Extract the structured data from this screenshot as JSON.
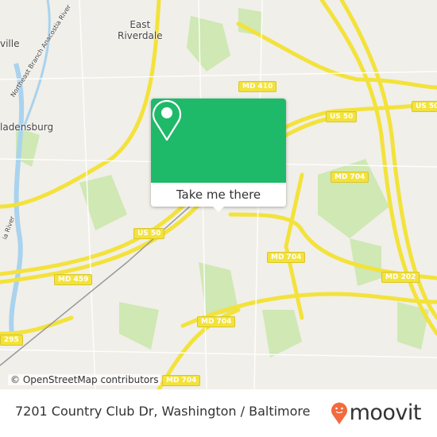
{
  "map": {
    "places": [
      {
        "id": "east-riverdale",
        "label": "East\nRiverdale"
      },
      {
        "id": "bladensburg",
        "label": "ladensburg"
      },
      {
        "id": "hyattsville",
        "label": "ville"
      },
      {
        "id": "anacostia-ne",
        "label": "Northeast Branch Anacostia River"
      },
      {
        "id": "anacostia",
        "label": "ia River"
      }
    ],
    "shields": [
      "MD 410",
      "US 50",
      "US 50",
      "MD 704",
      "MD 704",
      "MD 704",
      "MD 704",
      "MD 459",
      "MD 202",
      "US 50",
      "295"
    ],
    "attribution": "© OpenStreetMap contributors",
    "colors": {
      "land": "#f1efe9",
      "park": "#cfe8b4",
      "road": "#f3e23b",
      "water": "#a9d3ef",
      "accent": "#1fb96a"
    }
  },
  "popup": {
    "icon": "map-pin-icon",
    "button_label": "Take me there"
  },
  "footer": {
    "title": "7201 Country Club Dr, Washington / Baltimore",
    "logo": "moovit",
    "logo_color": "#f26a3d"
  }
}
